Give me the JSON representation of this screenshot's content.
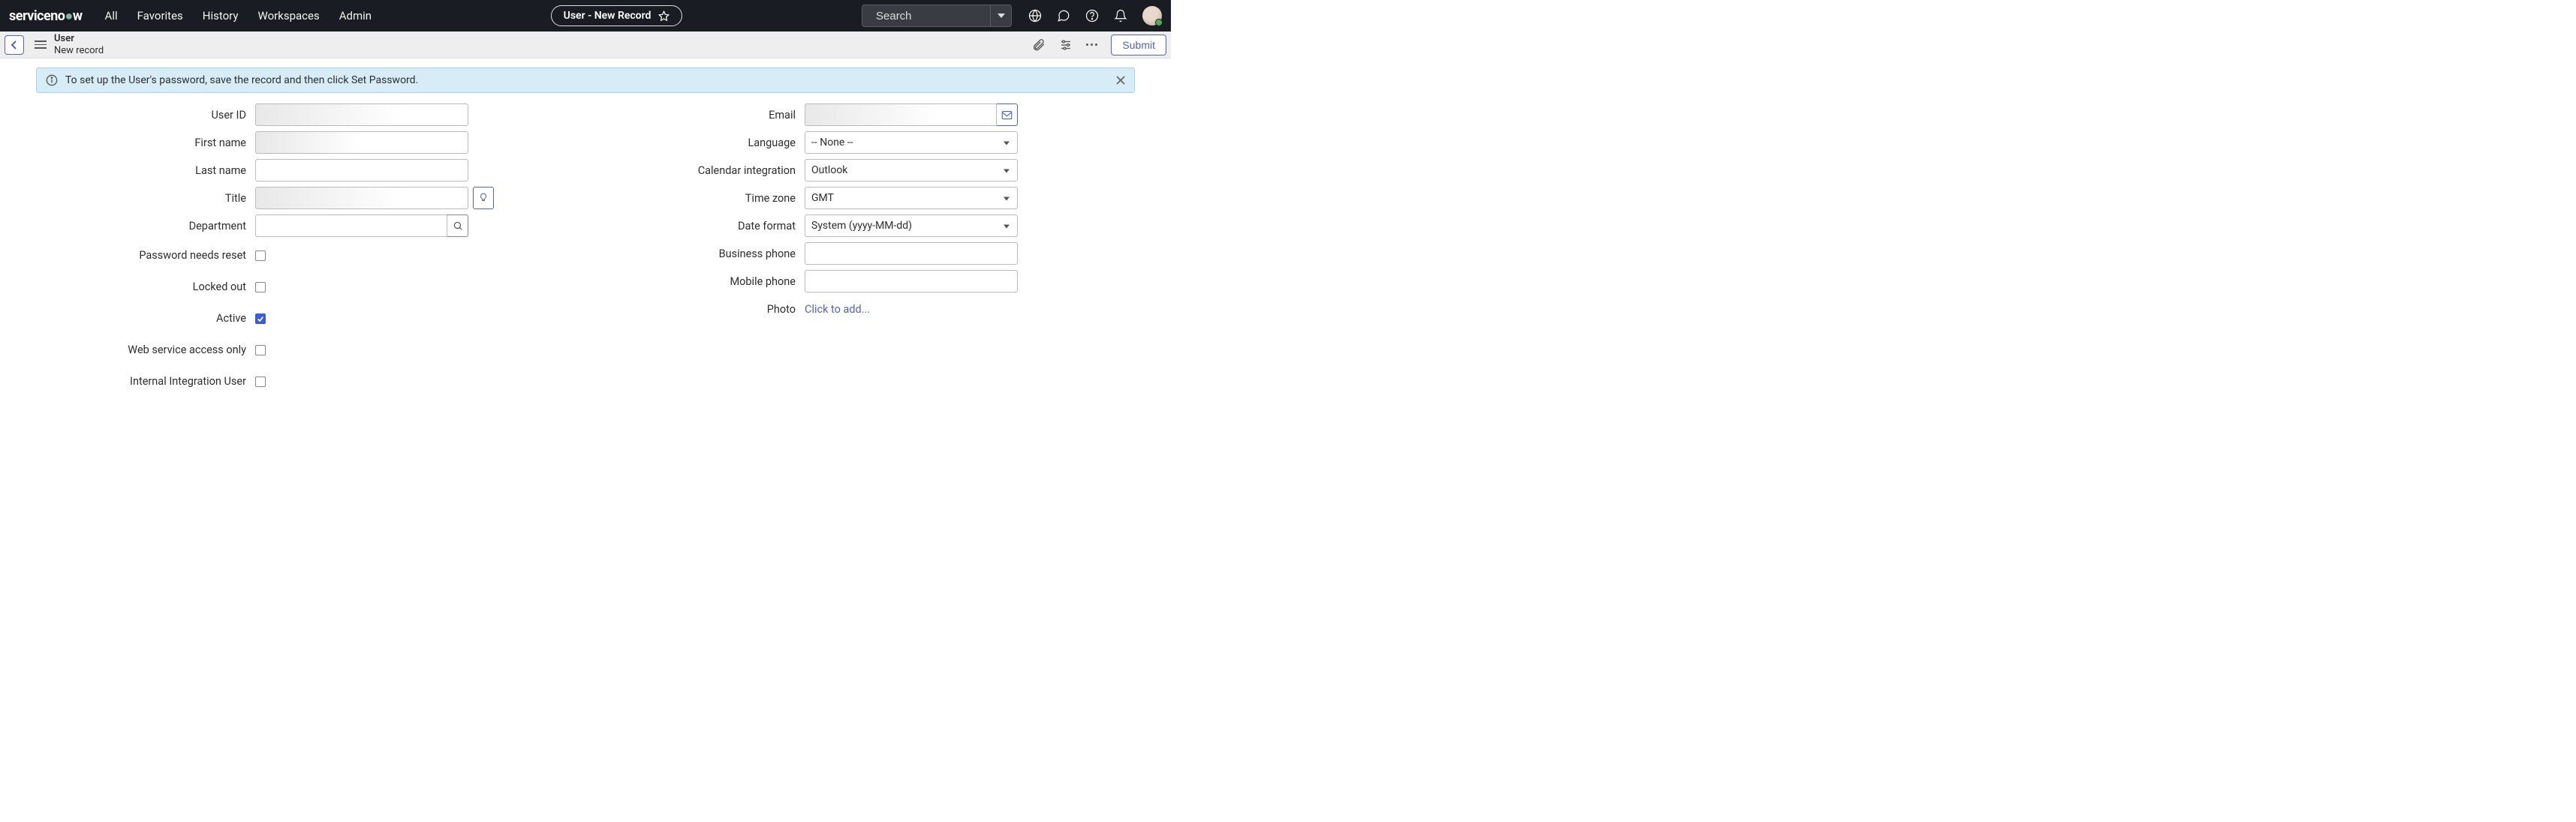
{
  "topnav": {
    "brand_prefix": "serviceno",
    "brand_suffix": "w",
    "tabs": [
      "All",
      "Favorites",
      "History",
      "Workspaces",
      "Admin"
    ],
    "pill_title": "User - New Record",
    "search_placeholder": "Search"
  },
  "subheader": {
    "title": "User",
    "subtitle": "New record",
    "submit_label": "Submit"
  },
  "banner": {
    "text": "To set up the User's password, save the record and then click Set Password."
  },
  "form": {
    "left": [
      {
        "name": "user-id",
        "label": "User ID",
        "type": "text",
        "value": "",
        "style": "gradient"
      },
      {
        "name": "first-name",
        "label": "First name",
        "type": "text",
        "value": "",
        "style": "gradient2"
      },
      {
        "name": "last-name",
        "label": "Last name",
        "type": "text",
        "value": ""
      },
      {
        "name": "title",
        "label": "Title",
        "type": "text_with_bulb",
        "value": "",
        "style": "gradient"
      },
      {
        "name": "department",
        "label": "Department",
        "type": "lookup",
        "value": ""
      },
      {
        "name": "password-needs-reset",
        "label": "Password needs reset",
        "type": "checkbox",
        "checked": false
      },
      {
        "name": "locked-out",
        "label": "Locked out",
        "type": "checkbox",
        "checked": false
      },
      {
        "name": "active",
        "label": "Active",
        "type": "checkbox",
        "checked": true
      },
      {
        "name": "web-service-access-only",
        "label": "Web service access only",
        "type": "checkbox",
        "checked": false
      },
      {
        "name": "internal-integration-user",
        "label": "Internal Integration User",
        "type": "checkbox",
        "checked": false
      }
    ],
    "right": [
      {
        "name": "email",
        "label": "Email",
        "type": "email_with_icon",
        "value": "",
        "style": "gradient"
      },
      {
        "name": "language",
        "label": "Language",
        "type": "select",
        "value": "-- None --"
      },
      {
        "name": "calendar-integration",
        "label": "Calendar integration",
        "type": "select",
        "value": "Outlook"
      },
      {
        "name": "time-zone",
        "label": "Time zone",
        "type": "select",
        "value": "GMT"
      },
      {
        "name": "date-format",
        "label": "Date format",
        "type": "select",
        "value": "System (yyyy-MM-dd)"
      },
      {
        "name": "business-phone",
        "label": "Business phone",
        "type": "text",
        "value": ""
      },
      {
        "name": "mobile-phone",
        "label": "Mobile phone",
        "type": "text",
        "value": ""
      },
      {
        "name": "photo",
        "label": "Photo",
        "type": "link",
        "value": "Click to add..."
      }
    ]
  }
}
